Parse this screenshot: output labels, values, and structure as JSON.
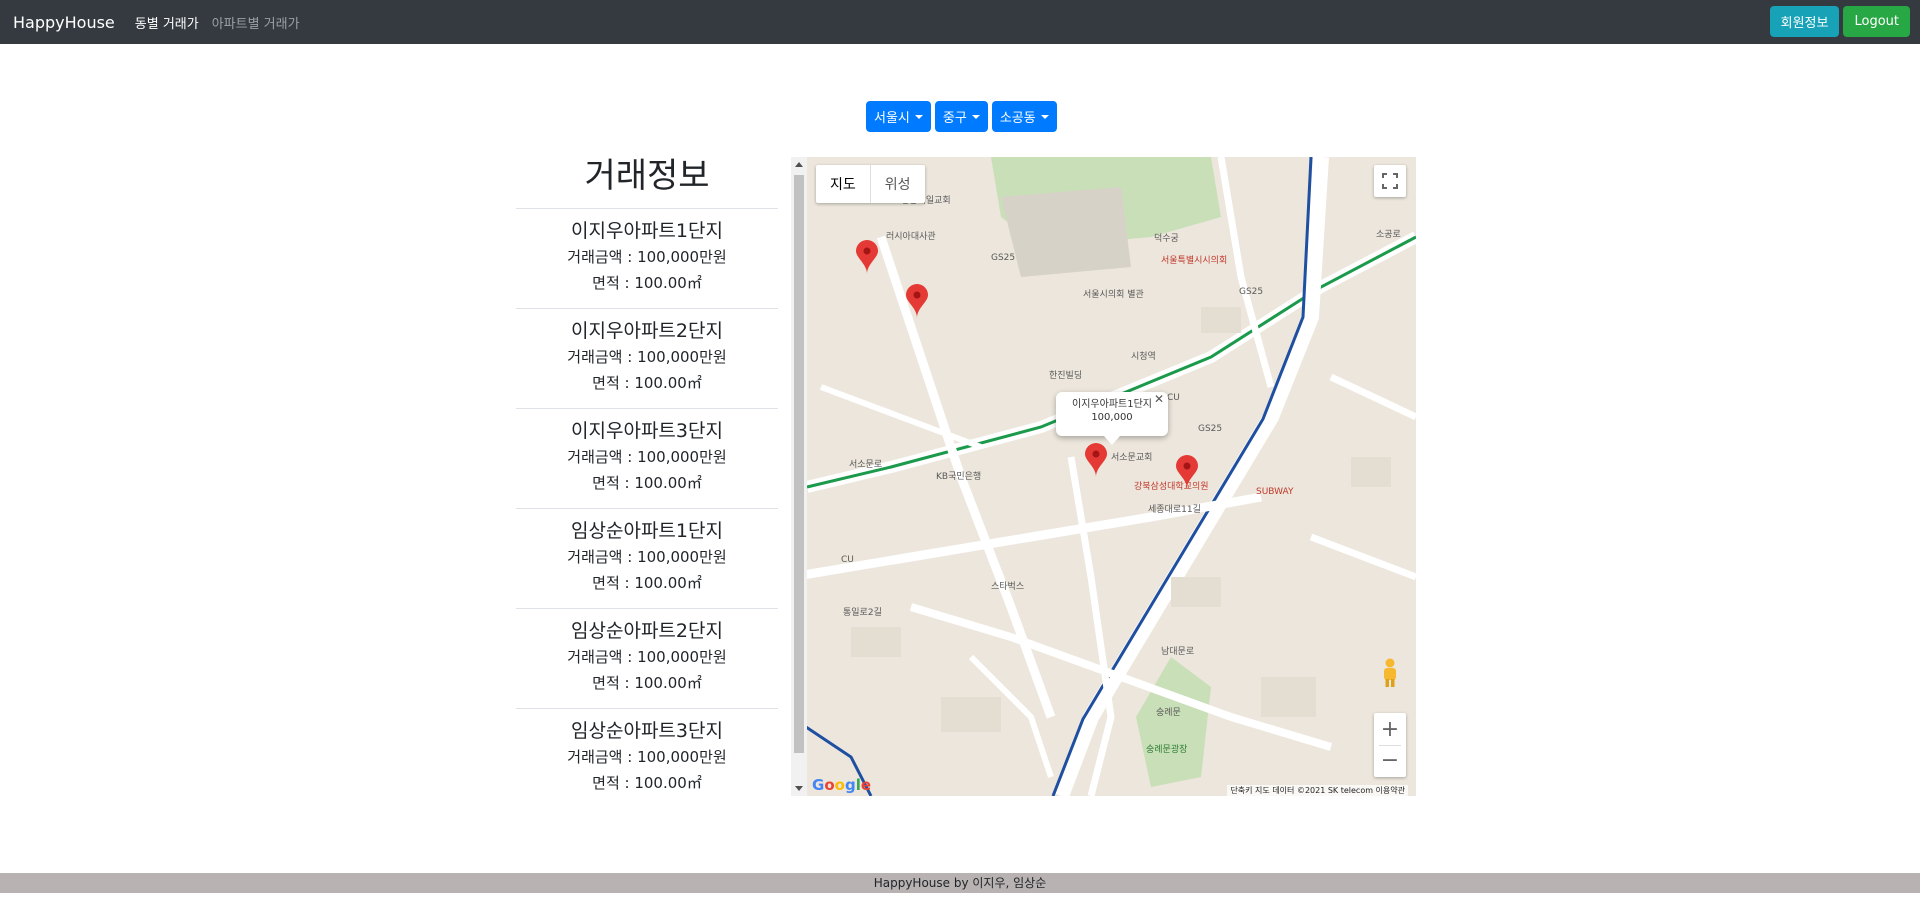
{
  "navbar": {
    "brand": "HappyHouse",
    "links": [
      "동별 거래가",
      "아파트별 거래가"
    ],
    "buttons": {
      "member_info": "회원정보",
      "logout": "Logout"
    }
  },
  "selectors": {
    "city": "서울시",
    "district": "중구",
    "dong": "소공동"
  },
  "deals": {
    "title": "거래정보",
    "items": [
      {
        "name": "이지우아파트1단지",
        "price": "거래금액 : 100,000만원",
        "area": "면적 : 100.00㎡"
      },
      {
        "name": "이지우아파트2단지",
        "price": "거래금액 : 100,000만원",
        "area": "면적 : 100.00㎡"
      },
      {
        "name": "이지우아파트3단지",
        "price": "거래금액 : 100,000만원",
        "area": "면적 : 100.00㎡"
      },
      {
        "name": "임상순아파트1단지",
        "price": "거래금액 : 100,000만원",
        "area": "면적 : 100.00㎡"
      },
      {
        "name": "임상순아파트2단지",
        "price": "거래금액 : 100,000만원",
        "area": "면적 : 100.00㎡"
      },
      {
        "name": "임상순아파트3단지",
        "price": "거래금액 : 100,000만원",
        "area": "면적 : 100.00㎡"
      }
    ]
  },
  "map": {
    "type_buttons": {
      "map": "지도",
      "satellite": "위성"
    },
    "info_window": {
      "name": "이지우아파트1단지",
      "price": "100,000"
    },
    "attribution": "단축키   지도 데이터 ©2021 SK telecom   이용약관",
    "google": "Google",
    "labels": {
      "deoksugung": "덕수궁",
      "city_hall_station": "시청역",
      "seoul_plaza_hotel": "서울시의회 별관",
      "russian_embassy": "러시아대사관",
      "gs25_a": "GS25",
      "gs25_b": "GS25",
      "gs25_c": "GS25",
      "cu_a": "CU",
      "cu_b": "CU",
      "subway": "SUBWAY",
      "sogong_church": "서소문교회",
      "sejong_11": "세종대로11길",
      "namdaemun_ro": "남대문로",
      "seosomun_ro": "서소문로",
      "sungnyemun": "숭례문",
      "tongil_ro": "통일로2길",
      "hanjin": "한진빌딩",
      "kb_bank": "KB국민은행",
      "starbucks": "스타벅스",
      "cheilgarden": "정동제일교회",
      "sogong_ro": "소공로",
      "sungnyemun_square": "숭례문광장",
      "hospital": "강북삼성대학교의원",
      "seoul_city": "서울특별시시의회"
    },
    "colors": {
      "marker": "#e53935",
      "subway_green": "#1b9a4b",
      "subway_blue": "#1e4fa0"
    }
  },
  "footer": "HappyHouse by 이지우, 임상순"
}
